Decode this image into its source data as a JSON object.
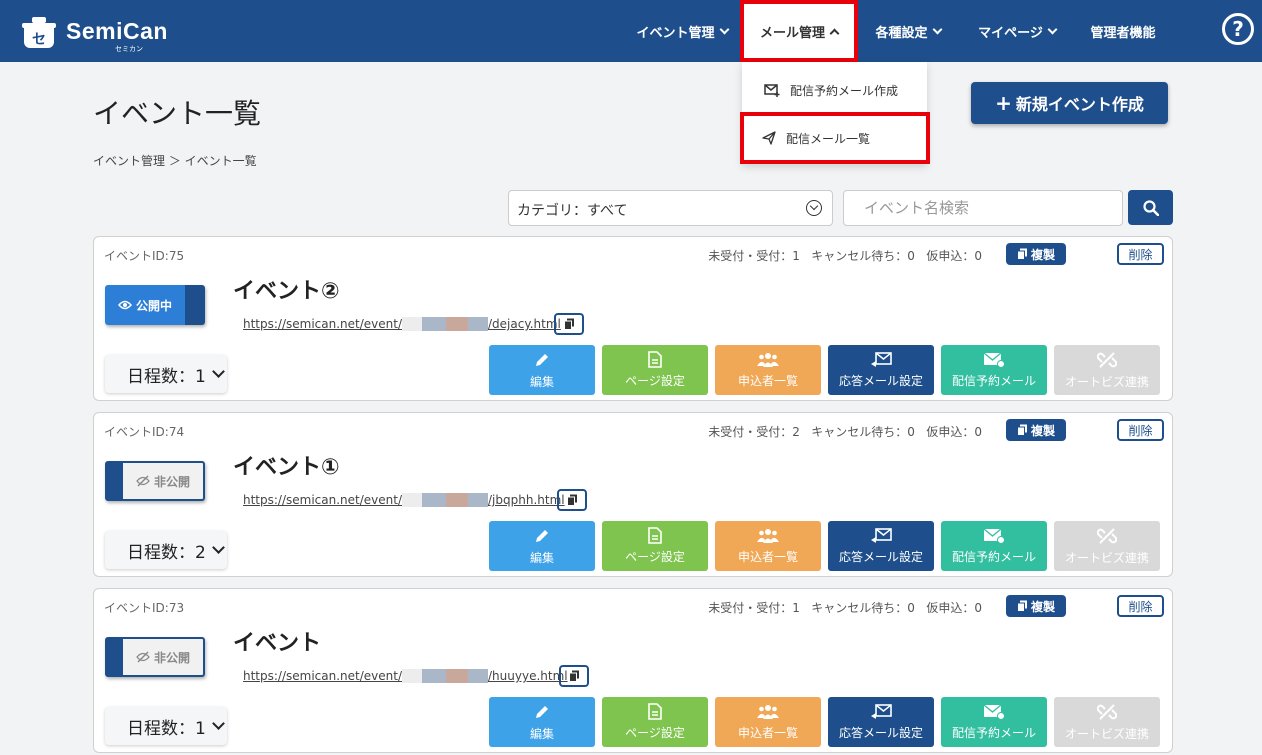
{
  "header": {
    "logo_name": "SemiCan",
    "logo_sub": "セミカン",
    "nav": [
      "イベント管理",
      "メール管理",
      "各種設定",
      "マイページ",
      "管理者機能"
    ],
    "help": "?"
  },
  "dropdown": {
    "items": [
      "配信予約メール作成",
      "配信メール一覧"
    ]
  },
  "page": {
    "title": "イベント一覧",
    "breadcrumb": "イベント管理  ＞ イベント一覧",
    "new_button": "新規イベント作成",
    "new_plus": "+",
    "category": "カテゴリ：すべて",
    "search_placeholder": "イベント名検索"
  },
  "labels": {
    "dup": "複製",
    "del": "削除",
    "actions": [
      "編集",
      "ページ設定",
      "申込者一覧",
      "応答メール設定",
      "配信予約メール",
      "オートビズ連携"
    ]
  },
  "events": [
    {
      "id": "イベントID:75",
      "stats": "未受付・受付：1   キャンセル待ち：0   仮申込：0",
      "status": "公開中",
      "title": "イベント②",
      "url_prefix": "https://semican.net/event/",
      "url_suffix": "/dejacy.html",
      "days": "日程数：1"
    },
    {
      "id": "イベントID:74",
      "stats": "未受付・受付：2   キャンセル待ち：0   仮申込：0",
      "status": "非公開",
      "title": "イベント①",
      "url_prefix": "https://semican.net/event/",
      "url_suffix": "/jbqphh.html",
      "days": "日程数：2"
    },
    {
      "id": "イベントID:73",
      "stats": "未受付・受付：1   キャンセル待ち：0   仮申込：0",
      "status": "非公開",
      "title": "イベント",
      "url_prefix": "https://semican.net/event/",
      "url_suffix": "/huuyye.html",
      "days": "日程数：1"
    }
  ],
  "colors": {
    "brand": "#1e4f8c",
    "highlight": "#e8000b"
  }
}
